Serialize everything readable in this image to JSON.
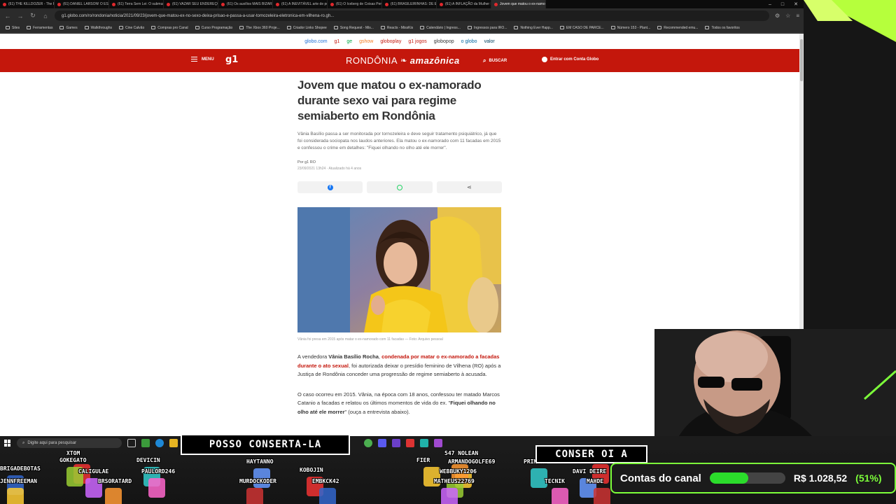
{
  "browser": {
    "tabs": [
      {
        "label": "(61) THE KILLDOZER - The Reason"
      },
      {
        "label": "(61) DANIEL LARSON! O ESCOVA"
      },
      {
        "label": "(61) Terra Sem Lei: O submundo"
      },
      {
        "label": "(61) VAZAR SEU ENDEREÇO HOJE"
      },
      {
        "label": "(61) Os auxílios MAIS BIZARROS"
      },
      {
        "label": "(61) A INEVITÁVEL arte de política"
      },
      {
        "label": "(61) O Iceberg de Coisas Perturbadoras"
      },
      {
        "label": "(61) BRASILEIRINHAS: DE EMPRESA"
      },
      {
        "label": "(61) A INFLAÇÃO da Mulher FEIA"
      },
      {
        "label": "Jovem que matou o ex-namorado"
      }
    ],
    "url": "g1.globo.com/ro/rondonia/noticia/2021/09/23/jovem-que-matou-ex-no-sexo-deixa-prisao-e-passa-a-usar-tornozeleira-eletronica-em-vilhena-ro.gh...",
    "bookmarks": [
      "Sites",
      "Ferramentas",
      "Games",
      "Walkthroughs",
      "Cine Calvão",
      "Compras pro Canal",
      "Curso Programação",
      "The Xbox 360 Proje...",
      "Criador Links Shopee",
      "Song Request - Mis...",
      "Reacts - MissKis",
      "Calendário | Ingress...",
      "Ingressos para IRO...",
      "Nothing Ever Happ...",
      "EM CASO DE PARCE...",
      "Número 153 - Plant...",
      "Recommended emu...",
      "Todos os favoritos"
    ]
  },
  "site": {
    "globo_nav": [
      "globo.com",
      "g1",
      "ge",
      "gshow",
      "globoplay",
      "g1 jogos",
      "globopop",
      "o globo",
      "valor"
    ],
    "menu_label": "MENU",
    "logo": "g1",
    "region": "RONDÔNIA",
    "affiliate": "amazônica",
    "search_label": "BUSCAR",
    "login_label": "Entrar com Conta Globo"
  },
  "article": {
    "title": "Jovem que matou o ex-namorado durante sexo vai para regime semiaberto em Rondônia",
    "subtitle": "Vânia Basílio passa a ser monitorada por tornozeleira e deve seguir tratamento psiquiátrico, já que foi considerada sociopata nos laudos anteriores. Ela matou o ex-namorado com 11 facadas em 2015 e confessou o crime em detalhes: \"Fiquei olhando no olho até ele morrer\".",
    "byline": "Por g1 RO",
    "date": "23/09/2021 13h24 · Atualizado há 4 anos",
    "share": [
      "facebook-icon",
      "whatsapp-icon",
      "share-icon"
    ],
    "caption": "Vânia foi presa em 2015 após matar o ex-namorado com 11 facadas — Foto: Arquivo pessoal",
    "p1": {
      "a": "A vendedora ",
      "name": "Vânia Basílio Rocha",
      "b": ", ",
      "link": "condenada por matar o ex-namorado a facadas durante o ato sexual",
      "c": ", foi autorizada deixar o presídio feminino de Vilhena (RO) após a Justiça de Rondônia conceder uma progressão de regime semiaberto à acusada."
    },
    "p2": {
      "a": "O caso ocorreu em 2015. Vânia, na época com 18 anos, confessou ter matado Marcos Catanio a facadas e relatou os últimos momentos de vida do ex. \"",
      "quote": "Fiquei olhando no olho até ele morrer",
      "b": "\" (ouça a entrevista abaixo)."
    }
  },
  "taskbar": {
    "search_placeholder": "Digite aqui para pesquisar"
  },
  "stream": {
    "bubble1": "POSSO CONSERTA-LA",
    "bubble2": "CONSER OI A",
    "nicks": [
      "XTOM",
      "BRIGADEBOTAS",
      "JENNFREEMAN",
      "GOKEGATO",
      "CALIGULAE",
      "BRSORATARD",
      "DEVICIN",
      "PAULORD246",
      "HAYTANNO",
      "MURDOCKODER",
      "KOBOJIN",
      "EMBKCK42",
      "ARMANDOGOLFE69",
      "WEBBUKY1206",
      "MATHEUS22769",
      "547 NOLEAN",
      "PRIMORO",
      "TECNIK",
      "DAVI DEIRE",
      "MAHDE",
      "NIRIN4261",
      "BREJAL",
      "FIER"
    ],
    "goal": {
      "title": "Contas do canal",
      "amount": "R$ 1.028,52",
      "percent_label": "(51%)",
      "progress": 0.51,
      "color": "#7dff3a"
    }
  }
}
